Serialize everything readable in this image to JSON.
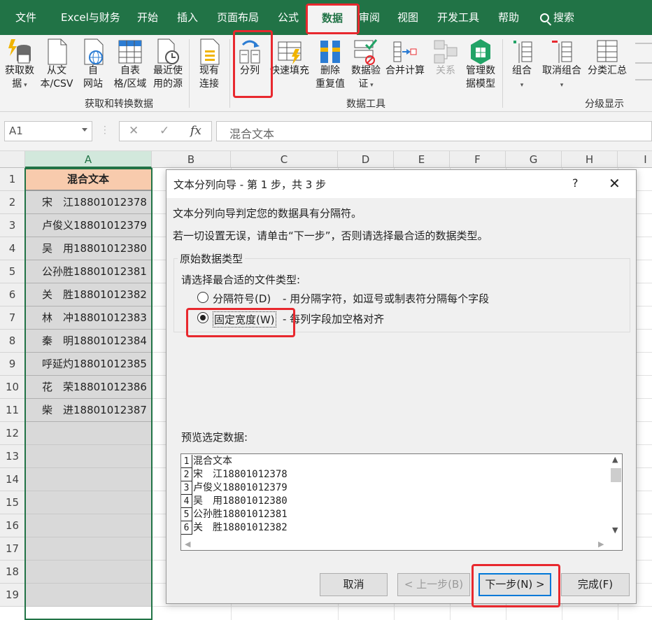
{
  "menu": {
    "tabs": [
      "文件",
      "Excel与财务",
      "开始",
      "插入",
      "页面布局",
      "公式",
      "数据",
      "审阅",
      "视图",
      "开发工具",
      "帮助"
    ],
    "active": "数据",
    "search": "搜索"
  },
  "ribbon": {
    "get_data": {
      "l1": "获取数",
      "l2": "据"
    },
    "from_csv": {
      "l1": "从文",
      "l2": "本/CSV"
    },
    "from_web": {
      "l1": "自",
      "l2": "网站"
    },
    "from_table": {
      "l1": "自表",
      "l2": "格/区域"
    },
    "recent": {
      "l1": "最近使",
      "l2": "用的源"
    },
    "existing": {
      "l1": "现有",
      "l2": "连接"
    },
    "group1": "获取和转换数据",
    "split": "分列",
    "flash_fill": "快速填充",
    "remove_dup": {
      "l1": "删除",
      "l2": "重复值"
    },
    "validation": {
      "l1": "数据验",
      "l2": "证"
    },
    "consolidate": "合并计算",
    "relations": "关系",
    "data_model": {
      "l1": "管理数",
      "l2": "据模型"
    },
    "group2": "数据工具",
    "group_btn": "组合",
    "ungroup": "取消组合",
    "subtotal": "分类汇总",
    "group3": "分级显示"
  },
  "formula_bar": {
    "name_box": "A1",
    "cancel": "✕",
    "enter": "✓",
    "fx": "fx",
    "content": "混合文本"
  },
  "grid": {
    "columns": [
      "A",
      "B",
      "C",
      "D",
      "E",
      "F",
      "G",
      "H",
      "I"
    ],
    "rows": [
      "1",
      "2",
      "3",
      "4",
      "5",
      "6",
      "7",
      "8",
      "9",
      "10",
      "11",
      "12",
      "13",
      "14",
      "15",
      "16",
      "17",
      "18",
      "19"
    ],
    "cells": [
      "混合文本",
      "宋　江18801012378",
      "卢俊义18801012379",
      "吴　用18801012380",
      "公孙胜18801012381",
      "关　胜18801012382",
      "林　冲18801012383",
      "秦　明18801012384",
      "呼延灼18801012385",
      "花　荣18801012386",
      "柴　进18801012387"
    ]
  },
  "dialog": {
    "title": "文本分列向导 - 第 1 步，共 3 步",
    "help": "?",
    "close": "✕",
    "line1": "文本分列向导判定您的数据具有分隔符。",
    "line2": "若一切设置无误，请单击“下一步”，否则请选择最合适的数据类型。",
    "fieldset_title": "原始数据类型",
    "choose_label": "请选择最合适的文件类型:",
    "opt1": {
      "label": "分隔符号(D)",
      "desc": "- 用分隔字符，如逗号或制表符分隔每个字段"
    },
    "opt2": {
      "label": "固定宽度(W)",
      "desc": "- 每列字段加空格对齐"
    },
    "preview_label": "预览选定数据:",
    "preview": [
      {
        "n": "1",
        "t": "混合文本"
      },
      {
        "n": "2",
        "t": "宋　江18801012378"
      },
      {
        "n": "3",
        "t": "卢俊义18801012379"
      },
      {
        "n": "4",
        "t": "吴　用18801012380"
      },
      {
        "n": "5",
        "t": "公孙胜18801012381"
      },
      {
        "n": "6",
        "t": "关　胜18801012382"
      }
    ],
    "buttons": {
      "cancel": "取消",
      "back": "< 上一步(B)",
      "next": "下一步(N) >",
      "finish": "完成(F)"
    }
  },
  "colors": {
    "excel_green": "#217346",
    "header_fill": "#f8cbad",
    "highlight": "#e8282e"
  }
}
